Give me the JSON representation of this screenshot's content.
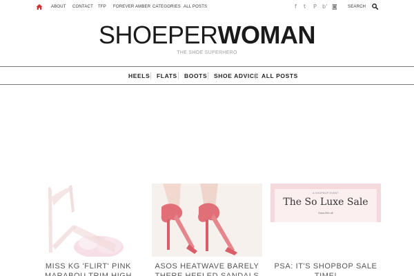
{
  "topbar": {
    "links": [
      "ABOUT",
      "CONTACT",
      "TFP",
      "FOREVER AMBER",
      "CATEGORIES",
      "ALL POSTS"
    ],
    "social_icons": [
      "facebook-icon",
      "twitter-icon",
      "pinterest-icon",
      "bloglovin-icon",
      "instagram-icon"
    ],
    "social_glyphs": [
      "f",
      "t",
      "P",
      "b'",
      "◙"
    ],
    "search_label": "SEARCH",
    "accent_color": "#d0312d"
  },
  "site": {
    "logo_light": "SHOEPER",
    "logo_bold": "WOMAN",
    "tagline": "THE SHOE SUPERHERO"
  },
  "mainnav": {
    "items": [
      "HEELS",
      "FLATS",
      "BOOTS",
      "SHOE ADVICE",
      "ALL POSTS"
    ]
  },
  "posts": [
    {
      "title": "MISS KG 'FLIRT' PINK MARABOU TRIM HIGH"
    },
    {
      "title": "ASOS HEATWAVE BARELY THERE HEELED SANDALS"
    },
    {
      "title": "PSA: IT'S SHOPBOP SALE TIME!",
      "banner_kicker": "A SHOPBOP EVENT",
      "banner_title": "The So Luxe Sale",
      "banner_text": "Extra 25% off"
    }
  ]
}
